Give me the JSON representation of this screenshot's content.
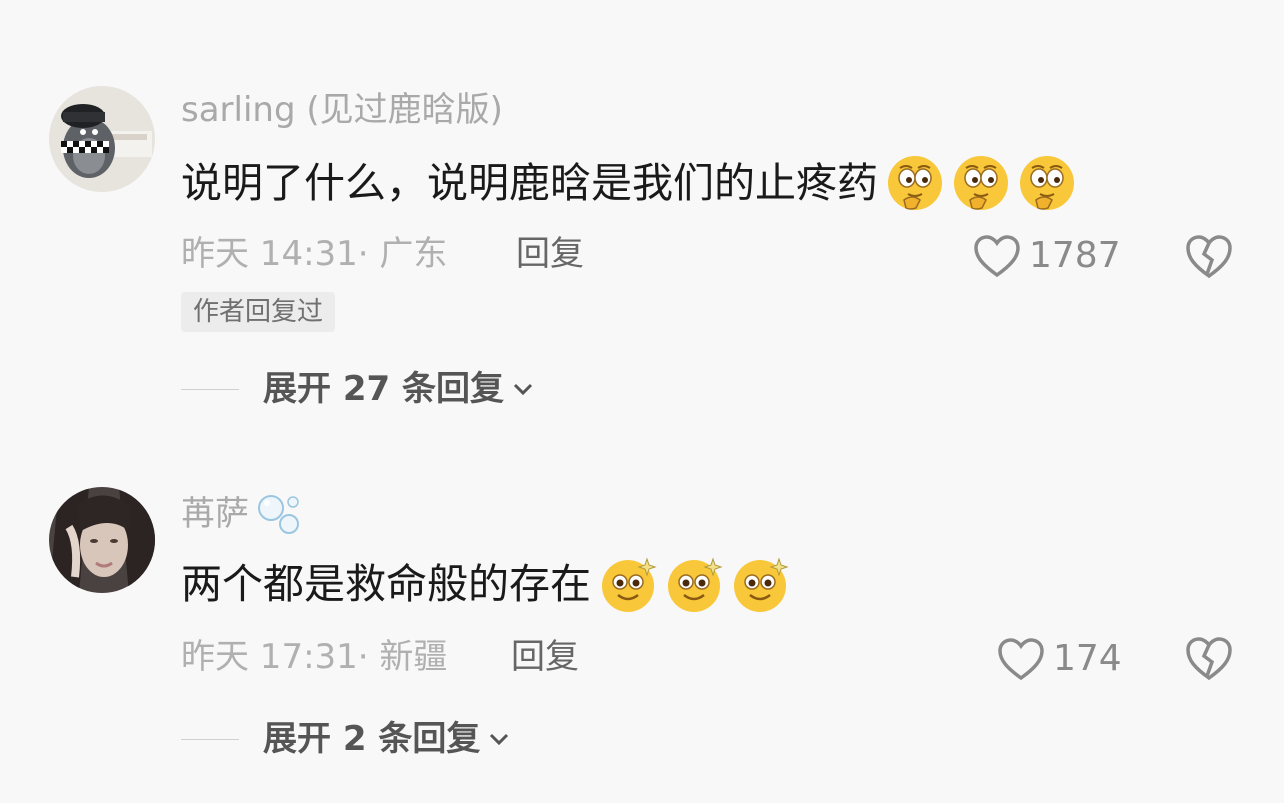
{
  "comments": [
    {
      "username": "sarling (见过鹿晗版)",
      "text": "说明了什么，说明鹿晗是我们的止疼药",
      "emoji": [
        "thinking-face-emoji",
        "thinking-face-emoji",
        "thinking-face-emoji"
      ],
      "time": "昨天 14:31·",
      "location": "广东",
      "reply_label": "回复",
      "likes": "1787",
      "author_badge": "作者回复过",
      "expand_label": "展开 27 条回复"
    },
    {
      "username": "苒萨",
      "text": "两个都是救命般的存在",
      "emoji": [
        "sparkle-eyes-emoji",
        "sparkle-eyes-emoji",
        "sparkle-eyes-emoji"
      ],
      "time": "昨天 17:31·",
      "location": "新疆",
      "reply_label": "回复",
      "likes": "174",
      "expand_label": "展开 2 条回复"
    }
  ],
  "colors": {
    "background": "#f8f8f8",
    "meta_text": "#b0b0b0",
    "main_text": "#1a1a1a",
    "username_text": "#a9a9a9",
    "emoji_yellow": "#f8c83a"
  }
}
